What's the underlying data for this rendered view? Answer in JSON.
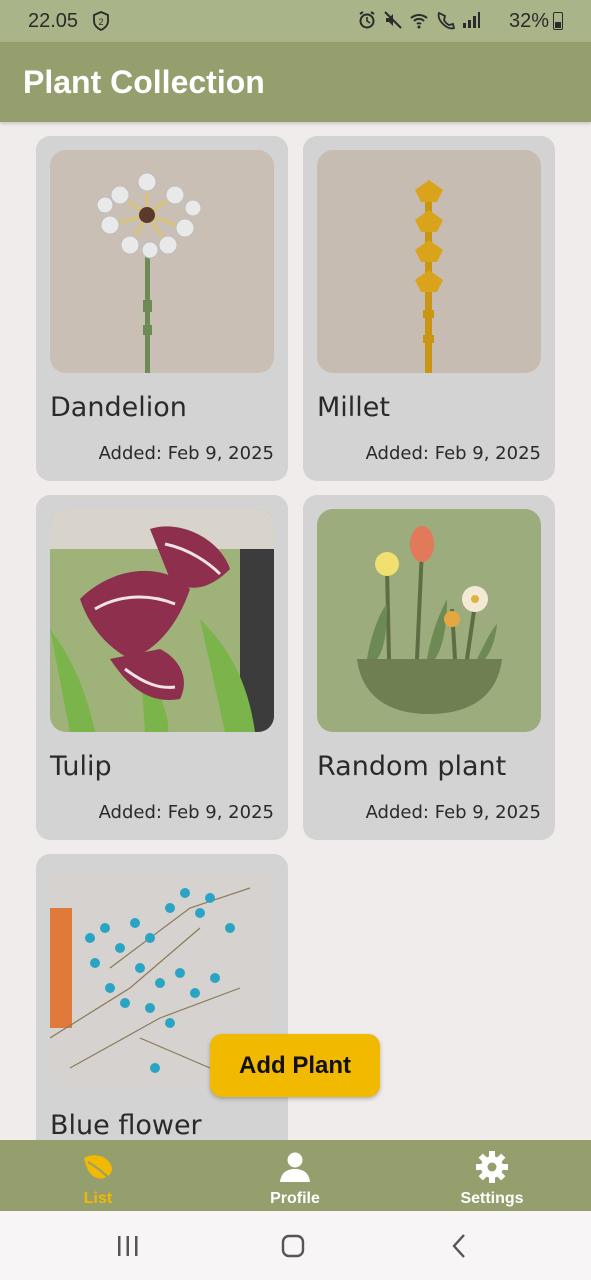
{
  "status_bar": {
    "time": "22.05",
    "shield_badge": "2",
    "battery": "32%",
    "icons": [
      "alarm-icon",
      "mute-icon",
      "wifi-icon",
      "wifi-call-icon",
      "signal-icon"
    ]
  },
  "app_bar": {
    "title": "Plant Collection"
  },
  "plants": [
    {
      "name": "Dandelion",
      "date": "Added: Feb 9, 2025"
    },
    {
      "name": "Millet",
      "date": "Added: Feb 9, 2025"
    },
    {
      "name": "Tulip",
      "date": "Added: Feb 9, 2025"
    },
    {
      "name": "Random plant",
      "date": "Added: Feb 9, 2025"
    },
    {
      "name": "Blue flower",
      "date": ""
    }
  ],
  "fab": {
    "label": "Add Plant"
  },
  "bottom_nav": {
    "items": [
      {
        "label": "List",
        "icon": "leaf-icon",
        "active": true
      },
      {
        "label": "Profile",
        "icon": "person-icon",
        "active": false
      },
      {
        "label": "Settings",
        "icon": "gear-icon",
        "active": false
      }
    ]
  },
  "colors": {
    "app_bar": "#959e6d",
    "accent": "#f1b900",
    "card": "#d3d3d3",
    "background": "#f0ecec"
  }
}
